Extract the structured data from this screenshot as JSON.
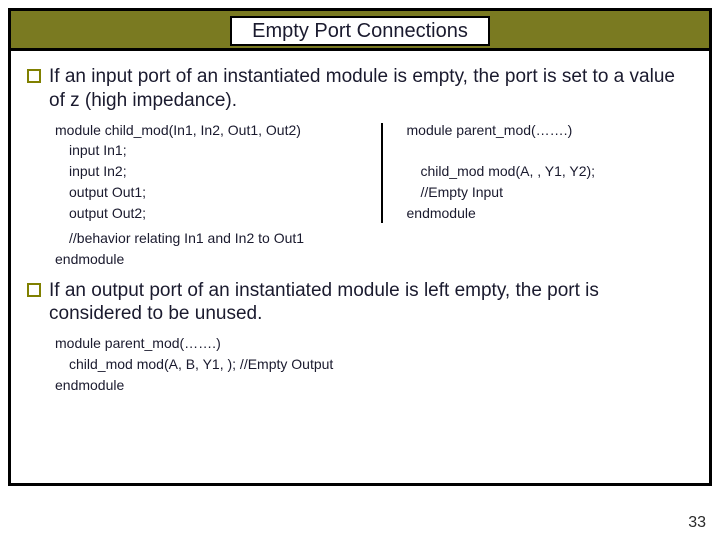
{
  "title": "Empty Port Connections",
  "bullets": [
    "If an input port of an instantiated module is empty, the port is set to a value of z (high impedance).",
    "If an output port of an instantiated module is left empty, the port is considered to be unused."
  ],
  "code_left": {
    "l1": "module child_mod(In1, In2, Out1, Out2)",
    "l2": "input In1;",
    "l3": "input In2;",
    "l4": "output Out1;",
    "l5": "output Out2;"
  },
  "code_right": {
    "r1": "module parent_mod(…….)",
    "r2": "child_mod mod(A, , Y1, Y2);",
    "r3": "//Empty Input",
    "r4": "endmodule"
  },
  "code_below1": {
    "b1": "//behavior relating In1 and In2 to Out1",
    "b2": "endmodule"
  },
  "code_below2": {
    "c1": "module parent_mod(…….)",
    "c2": "child_mod mod(A, B, Y1,  ); //Empty Output",
    "c3": "endmodule"
  },
  "page_number": "33"
}
